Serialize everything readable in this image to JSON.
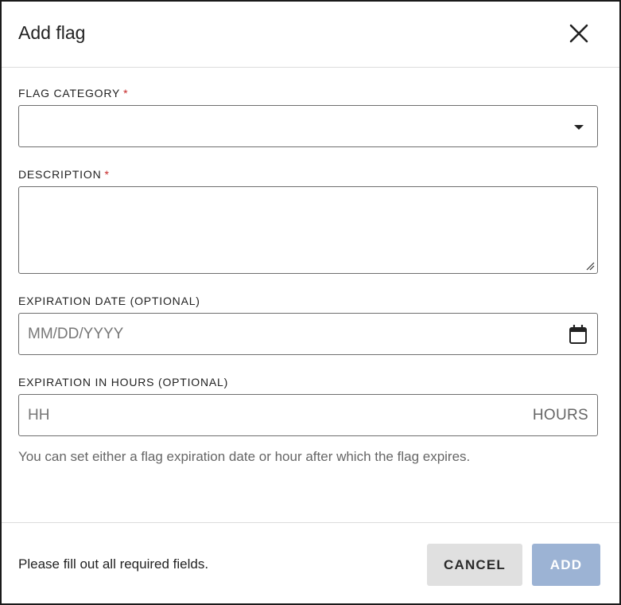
{
  "dialog": {
    "title": "Add flag",
    "close_icon": "close-icon"
  },
  "fields": {
    "category": {
      "label": "FLAG CATEGORY",
      "required_mark": "*",
      "value": "",
      "icon": "dropdown-arrow-icon"
    },
    "description": {
      "label": "DESCRIPTION",
      "required_mark": "*",
      "value": ""
    },
    "expiration_date": {
      "label": "EXPIRATION DATE (OPTIONAL)",
      "placeholder": "MM/DD/YYYY",
      "icon": "calendar-icon"
    },
    "expiration_hours": {
      "label": "EXPIRATION IN HOURS (OPTIONAL)",
      "placeholder": "HH",
      "suffix": "HOURS"
    },
    "help_text": "You can set either a flag expiration date or hour after which the flag expires."
  },
  "footer": {
    "message": "Please fill out all required fields.",
    "cancel_label": "CANCEL",
    "add_label": "ADD"
  },
  "colors": {
    "required": "#c62828",
    "add_button_disabled": "#9cb3d4",
    "cancel_button": "#e0e0e0"
  }
}
